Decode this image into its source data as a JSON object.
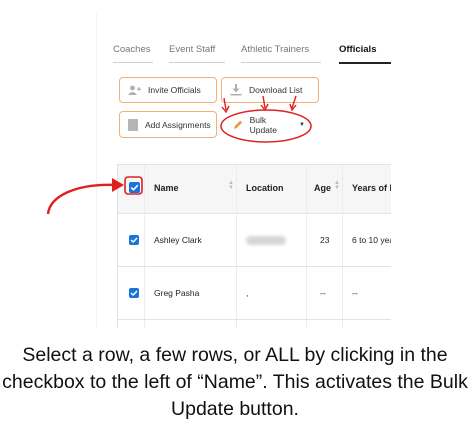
{
  "tabs": [
    "Coaches",
    "Event Staff",
    "Athletic Trainers",
    "Officials"
  ],
  "active_tab": "Officials",
  "buttons": {
    "invite": "Invite Officials",
    "download": "Download List",
    "add": "Add Assignments",
    "bulk": "Bulk Update"
  },
  "table": {
    "headers": [
      "Name",
      "Location",
      "Age",
      "Years of E"
    ],
    "rows": [
      {
        "name": "Ashley Clark",
        "location": "",
        "age": "23",
        "years": "6 to 10 year"
      },
      {
        "name": "Greg Pasha",
        "location": ",",
        "age": "--",
        "years": "--"
      }
    ]
  },
  "caption": "Select a row, a few rows, or ALL by clicking in the checkbox to the left of “Name”. This activates the Bulk Update button.",
  "colors": {
    "accent_orange": "#f0b27a",
    "annotation_red": "#e02020",
    "checkbox_blue": "#1a73d9"
  },
  "icons": [
    "add-user-icon",
    "download-icon",
    "document-icon",
    "pencil-icon",
    "dropdown-caret-icon",
    "checkbox-checked-icon",
    "sort-icon"
  ]
}
